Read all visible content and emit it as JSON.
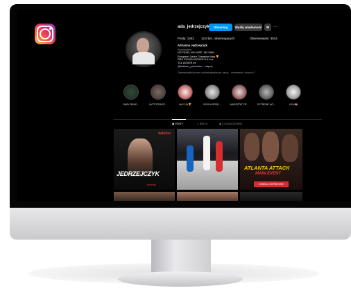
{
  "profile": {
    "username": "ada_jedrzejczyk",
    "follow_label": "Obserwuj",
    "message_label": "Wyślij wiadomość",
    "more_label": "···",
    "posts": "Posty: 1452",
    "followers": "12,8 tys. obserwujących",
    "following": "Obserwowani: 3814",
    "full_name": "Adrianna Jędrzejczyk",
    "category": "Sportowiec",
    "bio_lines": [
      "NO FEAR, NO HATE, NO PAIN",
      "European Junior Champion Italy 🏆",
      "PRO POLISH BOXER 5-0-0 w.",
      "TCL BOXER ee",
      "@babbon_promotion... więcej"
    ],
    "followed_by": "Obserwowany/a przez: rudzinskaawindows, pisza_ , emmawska + jeszcze 3"
  },
  "highlights": [
    {
      "label": "BABY BRUE..."
    },
    {
      "label": "MOTOTRACE..."
    },
    {
      "label": "4k/22 ✨🏆"
    },
    {
      "label": "IRON HORDE..."
    },
    {
      "label": "WARSZTAT CE..."
    },
    {
      "label": "EXTREME HO..."
    },
    {
      "label": "USA 🇺🇸"
    }
  ],
  "tabs": {
    "posts": "POSTY",
    "reels": "REELS",
    "tagged": "Z OZNACZENIEM"
  },
  "posts": {
    "post1_brand": "babilon",
    "post1_title": "JEDRZEJCZYK",
    "post1_footer": "eventin",
    "post3_title": "ATLANTA ATTACK",
    "post3_sub": "MAIN EVENT",
    "post3_cta": "ZOBACZ ODPAKOWE"
  },
  "colors": {
    "accent_blue": "#0095f6",
    "background": "#000000"
  }
}
